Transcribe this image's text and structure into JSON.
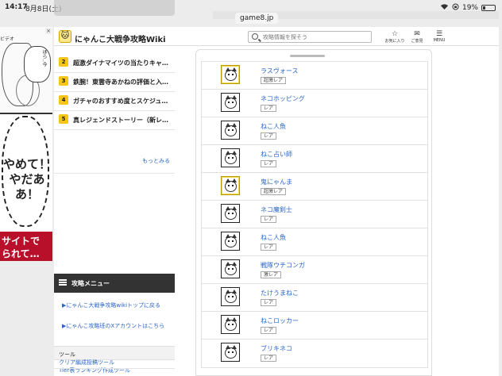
{
  "status": {
    "time": "14:17",
    "date": "8月8日(土)",
    "battery": "19%",
    "wifi_icon": "wifi-icon",
    "battery_icon": "battery-icon"
  },
  "browser": {
    "url": "game8.jp"
  },
  "ad": {
    "shout_line1": "やめて！",
    "shout_line2": "やだああ！",
    "promo_line1": "サイトで",
    "promo_line2": "られて…",
    "bubble_text": "ほら‥今",
    "tag": "ビデオ",
    "close": "×"
  },
  "header": {
    "logo_glyph": "🐱",
    "title": "にゃんこ大戦争攻略Wiki",
    "search_placeholder": "攻略情報を探そう",
    "favorites_label": "お気に入り",
    "feedback_label": "ご意見",
    "menu_label": "MENU"
  },
  "ranking": {
    "items": [
      {
        "num": "2",
        "text": "超激ダイナマイツの当たりキャラと…"
      },
      {
        "num": "3",
        "text": "鉄腕！東雲寺あかねの評価と入手方法"
      },
      {
        "num": "4",
        "text": "ガチャのおすすめ度とスケジュール…"
      },
      {
        "num": "5",
        "text": "真レジェンドストーリー（新レジェ…"
      }
    ],
    "more_label": "もっとみる"
  },
  "menu": {
    "title": "攻略メニュー",
    "links": [
      "▶にゃんこ大戦争攻略wikiトップに戻る",
      "▶にゃんこ攻略班のXアカウントはこちら"
    ],
    "tools_heading": "ツール",
    "tools": [
      "Tier表ランキング作成ツール",
      "クリア編成投稿ツール"
    ]
  },
  "characters": [
    {
      "name": "ラスヴォース",
      "rarity": "超激レア",
      "gold": true
    },
    {
      "name": "ネコホッピング",
      "rarity": "レア",
      "gold": false
    },
    {
      "name": "ねこ人魚",
      "rarity": "レア",
      "gold": false
    },
    {
      "name": "ねこ占い師",
      "rarity": "レア",
      "gold": false
    },
    {
      "name": "鬼にゃんま",
      "rarity": "超激レア",
      "gold": true
    },
    {
      "name": "ネコ魔剣士",
      "rarity": "レア",
      "gold": false
    },
    {
      "name": "ねこ人魚",
      "rarity": "レア",
      "gold": false
    },
    {
      "name": "戦隊ウチコンガ",
      "rarity": "激レア",
      "gold": false
    },
    {
      "name": "たけうまねこ",
      "rarity": "レア",
      "gold": false
    },
    {
      "name": "ねこロッカー",
      "rarity": "レア",
      "gold": false
    },
    {
      "name": "ブリキネコ",
      "rarity": "レア",
      "gold": false
    }
  ]
}
